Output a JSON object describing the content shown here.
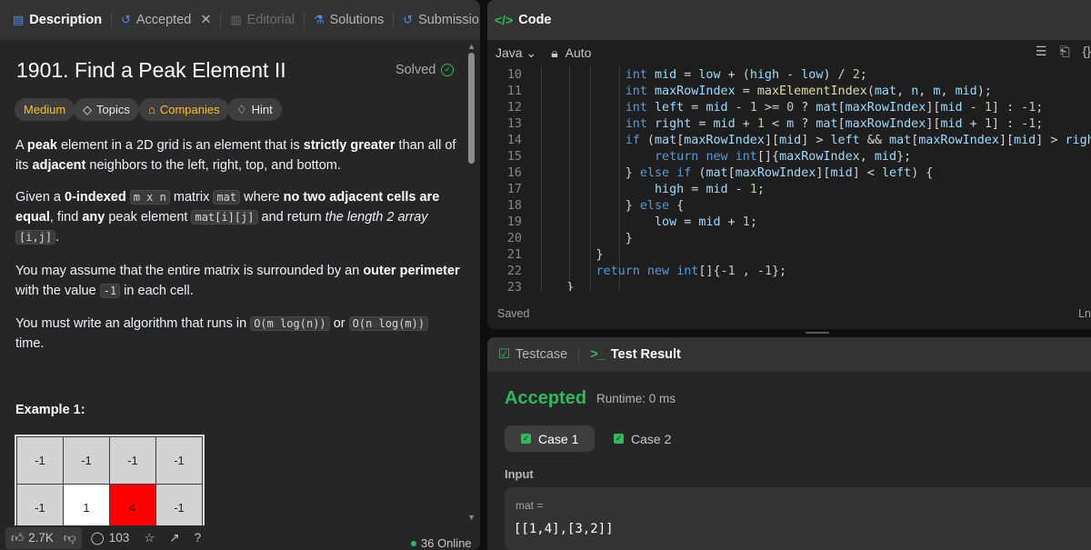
{
  "left_tabs": [
    {
      "label": "Description",
      "icon": "description-icon"
    },
    {
      "label": "Accepted",
      "icon": "history-icon"
    },
    {
      "label": "Editorial",
      "icon": "book-icon"
    },
    {
      "label": "Solutions",
      "icon": "flask-icon"
    },
    {
      "label": "Submission",
      "icon": "history-icon"
    }
  ],
  "problem": {
    "title": "1901. Find a Peak Element II",
    "status": "Solved",
    "chips": {
      "difficulty": "Medium",
      "topics": "Topics",
      "companies": "Companies",
      "hint": "Hint"
    },
    "p1": {
      "a": "A ",
      "b": "peak",
      "c": " element in a 2D grid is an element that is ",
      "d": "strictly greater",
      "e": " than all of its ",
      "f": "adjacent",
      "g": " neighbors to the left, right, top, and bottom."
    },
    "p2": {
      "a": "Given a ",
      "b": "0-indexed",
      "c": "m x n",
      "d": " matrix ",
      "e": "mat",
      "f": " where ",
      "g": "no two adjacent cells are equal",
      "h": ", find ",
      "i": "any",
      "j": " peak element ",
      "k": "mat[i][j]",
      "l": " and return ",
      "m": "the length 2 array",
      "n": "[i,j]",
      "o": "."
    },
    "p3": {
      "a": "You may assume that the entire matrix is surrounded by an ",
      "b": "outer perimeter",
      "c": " with the value ",
      "d": "-1",
      "e": " in each cell."
    },
    "p4": {
      "a": "You must write an algorithm that runs in ",
      "b": "O(m log(n))",
      "c": " or ",
      "d": "O(n log(m))",
      "e": " time."
    },
    "example_title": "Example 1:",
    "grid": [
      [
        "-1",
        "-1",
        "-1",
        "-1"
      ],
      [
        "-1",
        "1",
        "4",
        "-1"
      ]
    ]
  },
  "left_bottom": {
    "likes": "2.7K",
    "comments": "103",
    "online": "36 Online"
  },
  "code_panel": {
    "title": "Code",
    "language": "Java",
    "mode": "Auto",
    "saved": "Saved",
    "ln_label": "Ln",
    "lines": [
      {
        "n": "10",
        "t": "            int mid = low + (high - low) / 2;"
      },
      {
        "n": "11",
        "t": "            int maxRowIndex = maxElementIndex(mat, n, m, mid);"
      },
      {
        "n": "12",
        "t": "            int left = mid - 1 >= 0 ? mat[maxRowIndex][mid - 1] : -1;"
      },
      {
        "n": "13",
        "t": "            int right = mid + 1 < m ? mat[maxRowIndex][mid + 1] : -1;"
      },
      {
        "n": "14",
        "t": "            if (mat[maxRowIndex][mid] > left && mat[maxRowIndex][mid] > right) {"
      },
      {
        "n": "15",
        "t": "                return new int[]{maxRowIndex, mid};"
      },
      {
        "n": "16",
        "t": "            } else if (mat[maxRowIndex][mid] < left) {"
      },
      {
        "n": "17",
        "t": "                high = mid - 1;"
      },
      {
        "n": "18",
        "t": "            } else {"
      },
      {
        "n": "19",
        "t": "                low = mid + 1;"
      },
      {
        "n": "20",
        "t": "            }"
      },
      {
        "n": "21",
        "t": "        }"
      },
      {
        "n": "22",
        "t": "        return new int[]{-1 , -1};"
      },
      {
        "n": "23",
        "t": "    }"
      }
    ]
  },
  "result_panel": {
    "tab_testcase": "Testcase",
    "tab_result": "Test Result",
    "verdict": "Accepted",
    "runtime": "Runtime: 0 ms",
    "case1": "Case 1",
    "case2": "Case 2",
    "input_label": "Input",
    "var_name": "mat =",
    "var_value": "[[1,4],[3,2]]"
  },
  "colors": {
    "accent_green": "#2cbb5d",
    "medium_yellow": "#ffc01e",
    "peak_red": "#ff0000"
  }
}
